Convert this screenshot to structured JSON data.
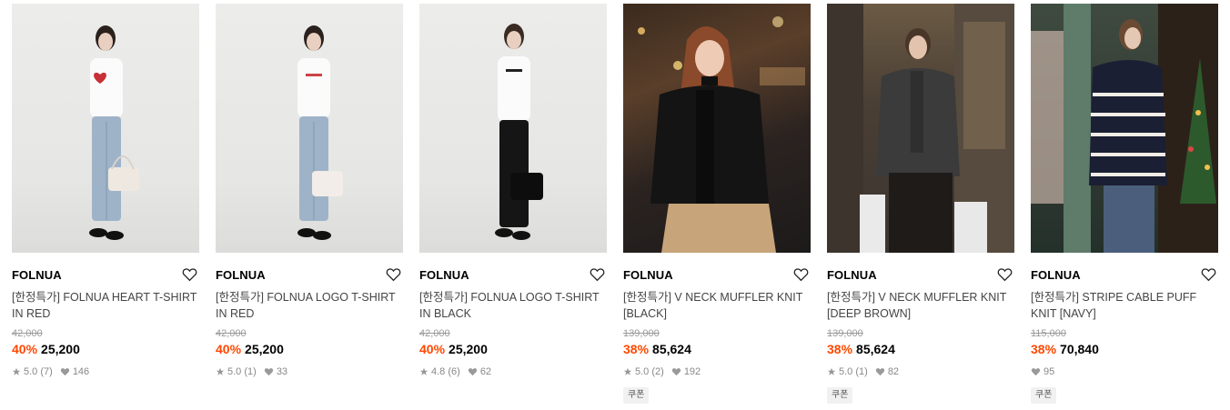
{
  "products": [
    {
      "brand": "FOLNUA",
      "name": "[한정특가] FOLNUA HEART T-SHIRT IN RED",
      "original_price": "42,000",
      "discount": "40%",
      "price": "25,200",
      "rating": "5.0",
      "reviews": "(7)",
      "likes": "146",
      "coupon": ""
    },
    {
      "brand": "FOLNUA",
      "name": "[한정특가] FOLNUA LOGO T-SHIRT IN RED",
      "original_price": "42,000",
      "discount": "40%",
      "price": "25,200",
      "rating": "5.0",
      "reviews": "(1)",
      "likes": "33",
      "coupon": ""
    },
    {
      "brand": "FOLNUA",
      "name": "[한정특가] FOLNUA LOGO T-SHIRT IN BLACK",
      "original_price": "42,000",
      "discount": "40%",
      "price": "25,200",
      "rating": "4.8",
      "reviews": "(6)",
      "likes": "62",
      "coupon": ""
    },
    {
      "brand": "FOLNUA",
      "name": "[한정특가] V NECK MUFFLER KNIT [BLACK]",
      "original_price": "139,000",
      "discount": "38%",
      "price": "85,624",
      "rating": "5.0",
      "reviews": "(2)",
      "likes": "192",
      "coupon": "쿠폰"
    },
    {
      "brand": "FOLNUA",
      "name": "[한정특가] V NECK MUFFLER KNIT [DEEP BROWN]",
      "original_price": "139,000",
      "discount": "38%",
      "price": "85,624",
      "rating": "5.0",
      "reviews": "(1)",
      "likes": "82",
      "coupon": "쿠폰"
    },
    {
      "brand": "FOLNUA",
      "name": "[한정특가] STRIPE CABLE PUFF KNIT [NAVY]",
      "original_price": "115,000",
      "discount": "38%",
      "price": "70,840",
      "rating": "",
      "reviews": "",
      "likes": "95",
      "coupon": "쿠폰"
    }
  ],
  "icons": {
    "wishlist": "heart-outline-icon",
    "rating": "star-icon",
    "likes": "heart-filled-icon"
  },
  "colors": {
    "discount": "#ff4800",
    "muted": "#888888"
  }
}
